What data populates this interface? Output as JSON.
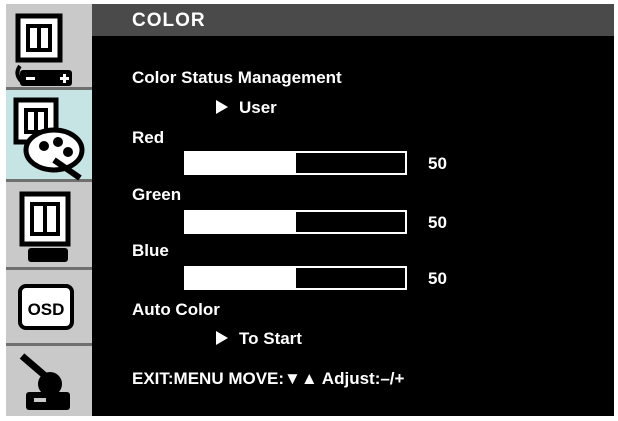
{
  "header": {
    "title": "COLOR"
  },
  "sidebar": {
    "tabs": [
      {
        "name": "brightness-contrast",
        "icon": "monitor-brightness-icon",
        "active": false
      },
      {
        "name": "color",
        "icon": "monitor-color-palette-icon",
        "active": true
      },
      {
        "name": "image",
        "icon": "monitor-image-icon",
        "active": false
      },
      {
        "name": "osd",
        "icon": "osd-icon",
        "active": false
      },
      {
        "name": "setup",
        "icon": "tools-setup-icon",
        "active": false
      }
    ]
  },
  "menu": {
    "color_status_label": "Color Status Management",
    "color_status_value": "User",
    "red": {
      "label": "Red",
      "value": "50",
      "level": 0.5
    },
    "green": {
      "label": "Green",
      "value": "50",
      "level": 0.5
    },
    "blue": {
      "label": "Blue",
      "value": "50",
      "level": 0.5
    },
    "auto_color_label": "Auto Color",
    "auto_color_action": "To Start"
  },
  "footer": {
    "hint": "EXIT:MENU  MOVE:▼▲  Adjust:–/+"
  },
  "colors": {
    "active_tab": "#c7e4e5",
    "sidebar": "#c9c9c9",
    "header": "#4a4a4a",
    "background": "#000000",
    "text": "#ffffff"
  }
}
